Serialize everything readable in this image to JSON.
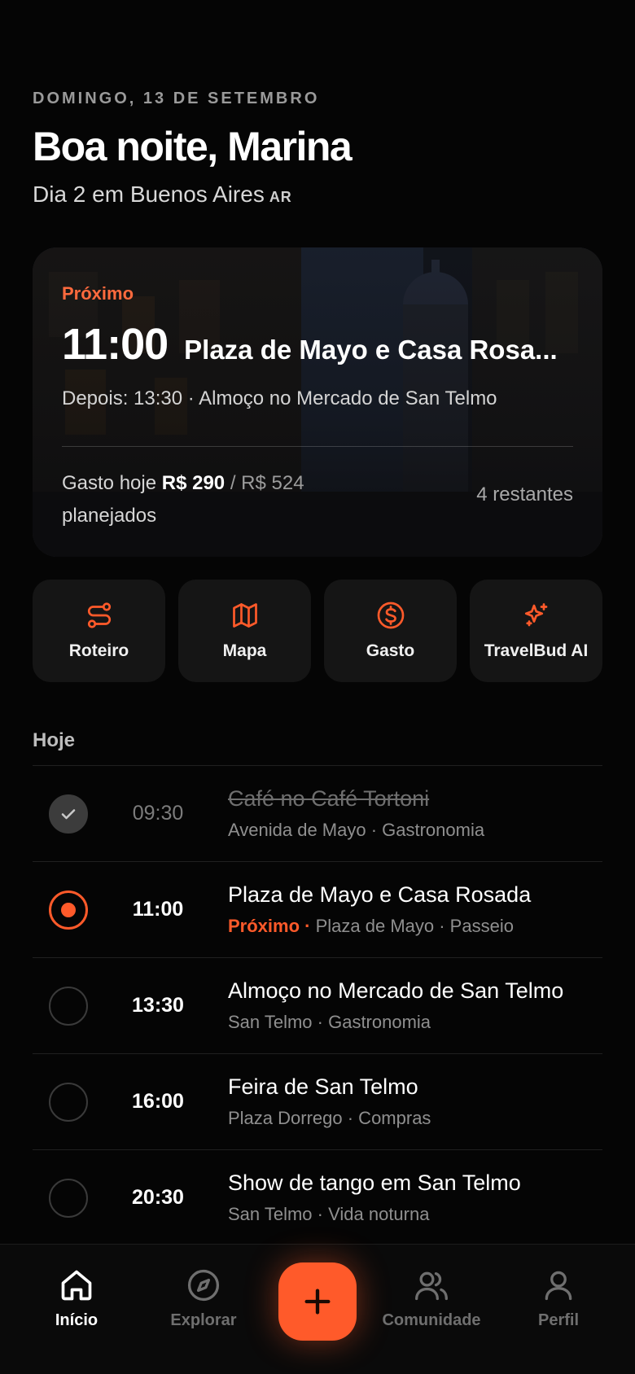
{
  "header": {
    "date": "DOMINGO, 13 DE SETEMBRO",
    "greeting": "Boa noite, Marina",
    "subtitle": "Dia 2 em Buenos Aires",
    "country_code": "AR"
  },
  "hero": {
    "label": "Próximo",
    "time": "11:00",
    "title": "Plaza de Mayo e Casa Rosa...",
    "after": "Depois: 13:30 · Almoço no Mercado de San Telmo",
    "spend_prefix": "Gasto hoje",
    "spend_amount": "R$ 290",
    "spend_budget": "/ R$ 524",
    "spend_suffix": "planejados",
    "remaining": "4 restantes"
  },
  "quick_actions": [
    {
      "label": "Roteiro",
      "icon": "route-icon"
    },
    {
      "label": "Mapa",
      "icon": "map-icon"
    },
    {
      "label": "Gasto",
      "icon": "dollar-icon"
    },
    {
      "label": "TravelBud AI",
      "icon": "sparkles-icon"
    }
  ],
  "today": {
    "title": "Hoje",
    "items": [
      {
        "time": "09:30",
        "title": "Café no Café Tortoni",
        "meta": "Avenida de Mayo · Gastronomia",
        "status": "done"
      },
      {
        "time": "11:00",
        "title": "Plaza de Mayo e Casa Rosada",
        "badge": "Próximo ·",
        "meta": "Plaza de Mayo · Passeio",
        "status": "current"
      },
      {
        "time": "13:30",
        "title": "Almoço no Mercado de San Telmo",
        "meta": "San Telmo · Gastronomia",
        "status": "pending"
      },
      {
        "time": "16:00",
        "title": "Feira de San Telmo",
        "meta": "Plaza Dorrego · Compras",
        "status": "pending"
      },
      {
        "time": "20:30",
        "title": "Show de tango em San Telmo",
        "meta": "San Telmo · Vida noturna",
        "status": "pending"
      }
    ]
  },
  "tabbar": {
    "items": [
      {
        "label": "Início",
        "icon": "home-icon",
        "active": true
      },
      {
        "label": "Explorar",
        "icon": "compass-icon"
      },
      {
        "label": "Comunidade",
        "icon": "users-icon"
      },
      {
        "label": "Perfil",
        "icon": "user-icon"
      }
    ],
    "fab_icon": "plus-icon"
  },
  "colors": {
    "accent": "#ff5a2a",
    "background": "#050505",
    "card": "#151515"
  }
}
